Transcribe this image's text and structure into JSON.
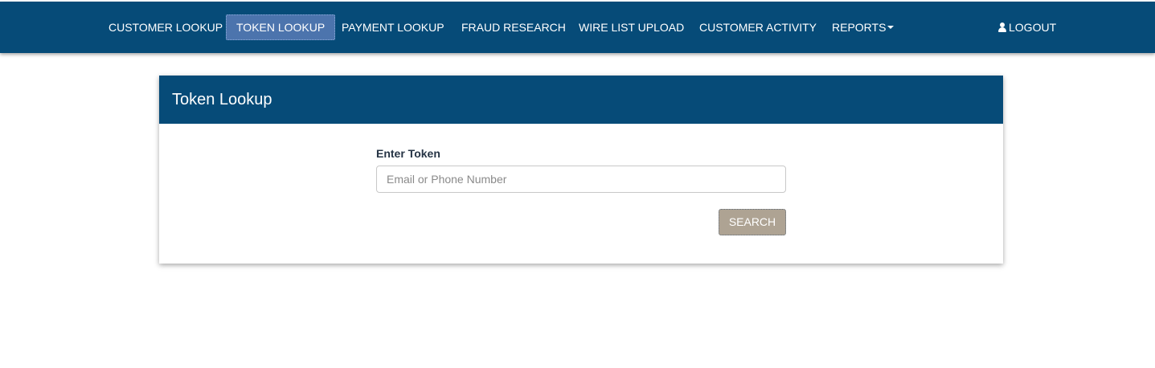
{
  "nav": {
    "items": [
      {
        "label": "CUSTOMER LOOKUP",
        "active": false
      },
      {
        "label": "TOKEN LOOKUP",
        "active": true
      },
      {
        "label": "PAYMENT LOOKUP",
        "active": false
      },
      {
        "label": "FRAUD RESEARCH",
        "active": false
      },
      {
        "label": "WIRE LIST UPLOAD",
        "active": false
      },
      {
        "label": "CUSTOMER ACTIVITY",
        "active": false
      },
      {
        "label": "REPORTS",
        "active": false,
        "dropdown": true
      }
    ],
    "logout_label": "LOGOUT",
    "logout_icon": "user-icon"
  },
  "panel": {
    "title": "Token Lookup",
    "field_label": "Enter Token",
    "input_value": "",
    "input_placeholder": "Email or Phone Number",
    "search_label": "SEARCH"
  },
  "colors": {
    "brand": "#064b78",
    "active_tab": "#4c74ad",
    "search_button": "#aea393"
  }
}
